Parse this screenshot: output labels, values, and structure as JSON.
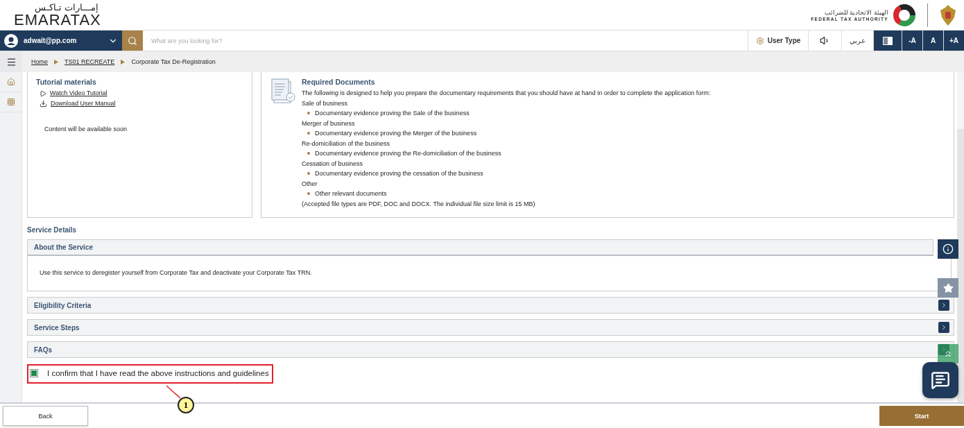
{
  "header": {
    "logo_arabic": "إمـــارات تـاكـس",
    "logo_text": "EMARATAX",
    "authority_arabic": "الهيئة الاتحادية للضرائب",
    "authority_english": "FEDERAL TAX AUTHORITY"
  },
  "navbar": {
    "user": "adwait@pp.com",
    "search": {
      "placeholder": "What are you looking for?"
    },
    "user_type": "User Type",
    "language": "عربي",
    "font_sizes": [
      "-A",
      "A",
      "+A"
    ]
  },
  "breadcrumb": [
    {
      "label": "Home",
      "link": true
    },
    {
      "label": "TS01 RECREATE",
      "link": true
    },
    {
      "label": "Corporate Tax De-Registration",
      "link": false
    }
  ],
  "tutorial": {
    "title": "Tutorial materials",
    "links": [
      {
        "kind": "video",
        "label": "Watch Video Tutorial"
      },
      {
        "kind": "download",
        "label": "Download User Manual"
      }
    ],
    "note": "Content will be available soon"
  },
  "required_documents": {
    "title": "Required Documents",
    "intro": "The following is designed to help you prepare the documentary requirements that you should have at hand in order to complete the application form:",
    "groups": [
      {
        "heading": "Sale of business",
        "items": [
          "Documentary evidence proving the Sale of the business"
        ]
      },
      {
        "heading": "Merger of business",
        "items": [
          "Documentary evidence proving the Merger of the business"
        ]
      },
      {
        "heading": "Re-domiciliation of the business",
        "items": [
          "Documentary evidence proving the Re-domiciliation of the business"
        ]
      },
      {
        "heading": "Cessation of business",
        "items": [
          "Documentary evidence proving the cessation of the business"
        ]
      },
      {
        "heading": "Other",
        "items": [
          "Other relevant documents"
        ]
      }
    ],
    "footnote": "(Accepted file types are PDF, DOC and DOCX. The individual file size limit is 15 MB)"
  },
  "service_details": {
    "title": "Service Details",
    "sections": [
      {
        "title": "About the Service",
        "expanded": true,
        "body": "Use this service to deregister yourself from Corporate Tax and deactivate your Corporate Tax TRN."
      },
      {
        "title": "Eligibility Criteria",
        "expanded": false
      },
      {
        "title": "Service Steps",
        "expanded": false
      },
      {
        "title": "FAQs",
        "expanded": false
      }
    ]
  },
  "confirm": {
    "label": "I confirm that I have read the above instructions and guidelines",
    "checked": true
  },
  "annotation": {
    "number": "1"
  },
  "footer": {
    "back": "Back",
    "start": "Start"
  }
}
